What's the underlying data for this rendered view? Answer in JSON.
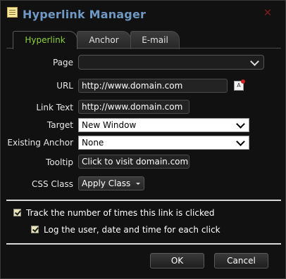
{
  "window": {
    "title": "Hyperlink Manager",
    "app_icon": "note-icon",
    "close_icon": "close-icon"
  },
  "tabs": [
    {
      "label": "Hyperlink",
      "active": true
    },
    {
      "label": "Anchor",
      "active": false
    },
    {
      "label": "E-mail",
      "active": false
    }
  ],
  "form": {
    "page_label": "Page",
    "page_value": "",
    "url_label": "URL",
    "url_value": "http://www.domain.com",
    "link_text_label": "Link Text",
    "link_text_value": "http://www.domain.com",
    "target_label": "Target",
    "target_value": "New Window",
    "existing_anchor_label": "Existing Anchor",
    "existing_anchor_value": "None",
    "tooltip_label": "Tooltip",
    "tooltip_value": "Click to visit domain.com",
    "css_class_label": "CSS Class",
    "css_class_value": "Apply Class"
  },
  "options": {
    "track_label": "Track the number of times this link is clicked",
    "track_checked": true,
    "log_label": "Log the user, date and time for each click",
    "log_checked": true
  },
  "buttons": {
    "ok_label": "OK",
    "cancel_label": "Cancel"
  },
  "colors": {
    "title": "#6f99c4",
    "active_tab": "#8fd23a",
    "background": "#111111"
  }
}
